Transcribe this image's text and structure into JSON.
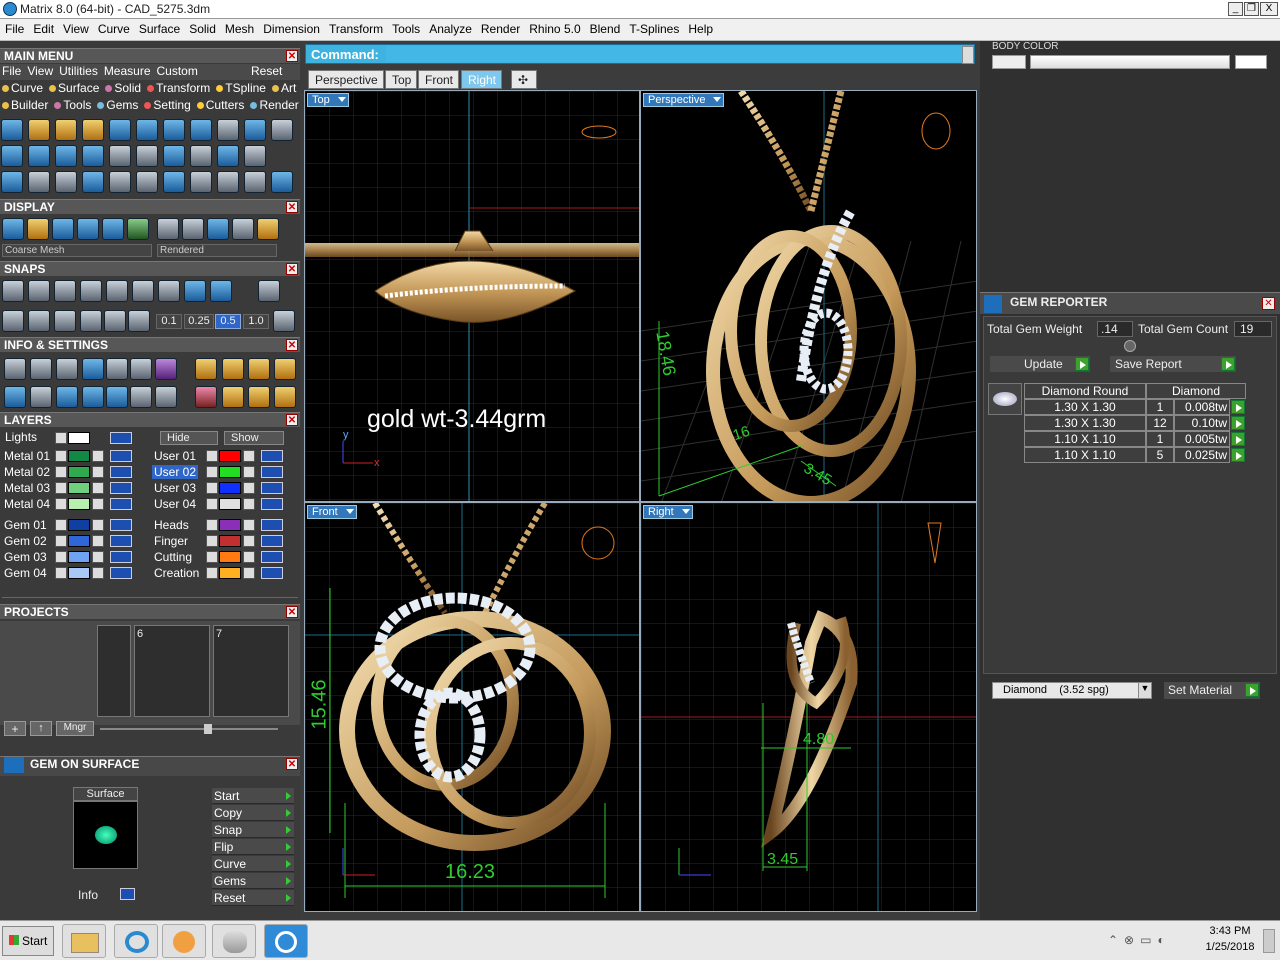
{
  "window": {
    "title": "Matrix 8.0 (64-bit) - CAD_5275.3dm",
    "buttons": [
      "_",
      "❐",
      "X"
    ]
  },
  "menubar": [
    "File",
    "Edit",
    "View",
    "Curve",
    "Surface",
    "Solid",
    "Mesh",
    "Dimension",
    "Transform",
    "Tools",
    "Analyze",
    "Render",
    "Rhino 5.0",
    "Blend",
    "T-Splines",
    "Help"
  ],
  "main_menu": {
    "title": "MAIN MENU",
    "items": [
      "File",
      "View",
      "Utilities",
      "Measure",
      "Custom"
    ],
    "reset": "Reset",
    "row2": [
      "Curve",
      "Surface",
      "Solid",
      "Transform",
      "TSpline",
      "Art"
    ],
    "row3": [
      "Builder",
      "Tools",
      "Gems",
      "Setting",
      "Cutters",
      "Render"
    ]
  },
  "display": {
    "title": "DISPLAY",
    "mesh": "Coarse Mesh",
    "mode": "Rendered"
  },
  "snaps": {
    "title": "SNAPS",
    "values": [
      "0.1",
      "0.25",
      "0.5",
      "1.0"
    ]
  },
  "info_settings": {
    "title": "INFO & SETTINGS"
  },
  "layers": {
    "title": "LAYERS",
    "lights": "Lights",
    "hide": "Hide",
    "show": "Show",
    "left": [
      "Metal 01",
      "Metal 02",
      "Metal 03",
      "Metal 04",
      "Gem 01",
      "Gem 02",
      "Gem 03",
      "Gem 04"
    ],
    "right": [
      "User 01",
      "User 02",
      "User 03",
      "User 04",
      "Heads",
      "Finger",
      "Cutting",
      "Creation"
    ],
    "left_colors": [
      "#118844",
      "#2faa4f",
      "#6fd07f",
      "#b8f0b0",
      "#0f3fa0",
      "#2f66d8",
      "#6fa2f0",
      "#a8c8f8"
    ],
    "right_colors": [
      "#ff0000",
      "#22dd22",
      "#1030ff",
      "#e0e0e0",
      "#8a2fb8",
      "#c03030",
      "#ff7a10",
      "#ffb020"
    ]
  },
  "projects": {
    "title": "PROJECTS",
    "slots": [
      "",
      "6",
      "7"
    ],
    "mngr": "Mngr"
  },
  "gem_on_surface": {
    "title": "GEM ON SURFACE",
    "surface": "Surface",
    "info": "Info",
    "buttons": [
      "Start",
      "Copy",
      "Snap",
      "Flip",
      "Curve",
      "Gems",
      "Reset"
    ]
  },
  "command": {
    "label": "Command:"
  },
  "tabs": [
    "Perspective",
    "Top",
    "Front",
    "Right"
  ],
  "viewports": {
    "top": {
      "label": "Top",
      "note": "gold wt-3.44grm"
    },
    "perspective": {
      "label": "Perspective",
      "dims": [
        "18.46",
        "16",
        "3.45"
      ]
    },
    "front": {
      "label": "Front",
      "dims": [
        "15.46",
        "16.23"
      ]
    },
    "right": {
      "label": "Right",
      "dims": [
        "4.80",
        "3.45"
      ]
    }
  },
  "body_color": {
    "title": "BODY COLOR"
  },
  "gem_reporter": {
    "title": "GEM REPORTER",
    "weight_label": "Total Gem Weight",
    "weight": ".14",
    "count_label": "Total Gem Count",
    "count": "19",
    "update": "Update",
    "save": "Save Report",
    "headers": [
      "Diamond Round",
      "Diamond"
    ],
    "rows": [
      [
        "1.30 X 1.30",
        "1",
        "0.008tw"
      ],
      [
        "1.30 X 1.30",
        "12",
        "0.10tw"
      ],
      [
        "1.10 X 1.10",
        "1",
        "0.005tw"
      ],
      [
        "1.10 X 1.10",
        "5",
        "0.025tw"
      ]
    ],
    "material": "Diamond    (3.52 spg)",
    "set_material": "Set Material"
  },
  "taskbar": {
    "start": "Start",
    "time": "3:43 PM",
    "date": "1/25/2018"
  },
  "colors": {
    "accent": "#3fb3e0",
    "gold": "#c9a05a",
    "gem": "#e8eef6",
    "green": "#3ba32b"
  }
}
